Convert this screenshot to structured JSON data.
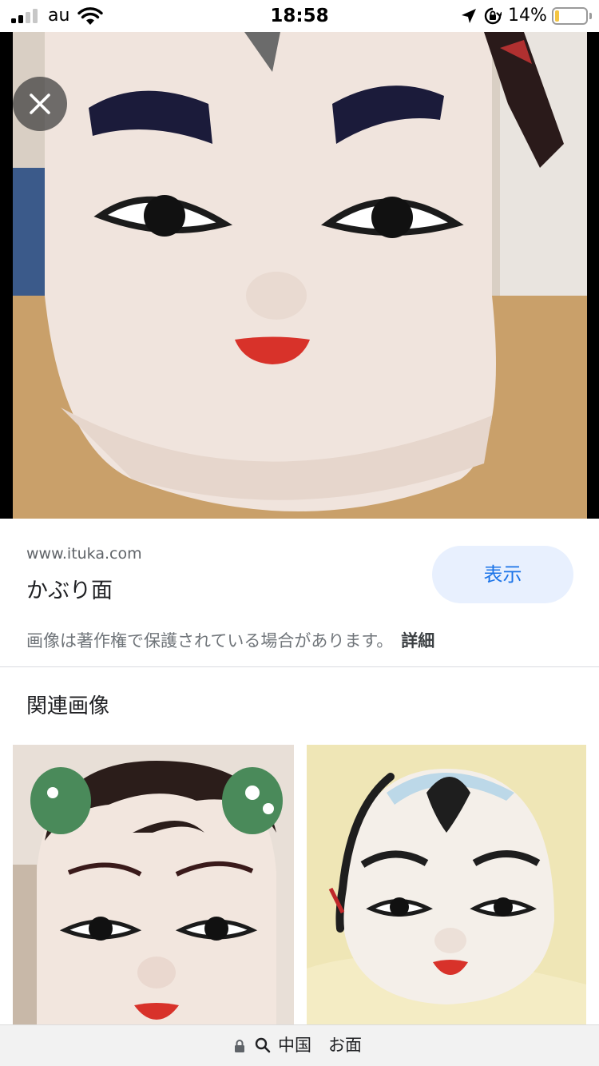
{
  "status_bar": {
    "carrier": "au",
    "time": "18:58",
    "battery_percent": "14%",
    "battery_level": 0.14,
    "signal_bars": 2,
    "icons": [
      "signal-icon",
      "wifi-icon",
      "location-arrow-icon",
      "orientation-lock-icon",
      "battery-icon"
    ]
  },
  "viewer": {
    "close_icon": "close-icon",
    "main_image_subject": "かぶり面"
  },
  "source": {
    "url": "www.ituka.com",
    "title": "かぶり面",
    "visit_label": "表示",
    "copyright_notice": "画像は著作権で保護されている場合があります。",
    "details_label": "詳細"
  },
  "related": {
    "heading": "関連画像"
  },
  "url_bar": {
    "text": "中国　お面",
    "icons": [
      "lock-icon",
      "search-icon"
    ]
  },
  "colors": {
    "accent_blue": "#1a73e8",
    "button_bg": "#e8f0fe",
    "battery_fill": "#f4c542"
  }
}
